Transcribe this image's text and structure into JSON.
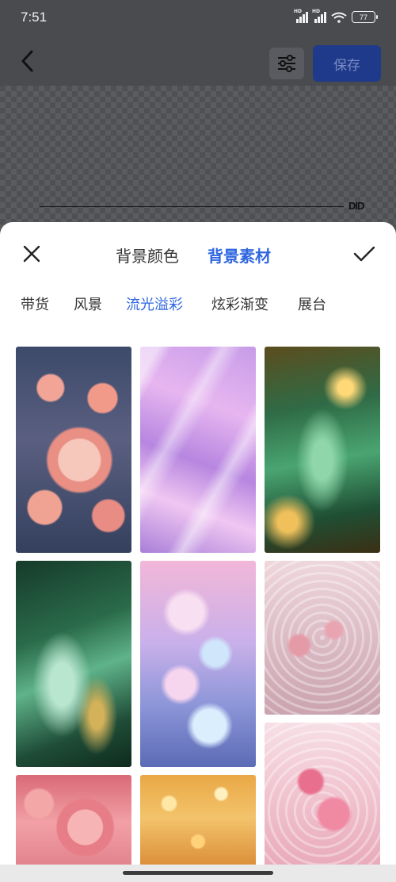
{
  "status": {
    "time": "7:51",
    "signal_tag": "HD",
    "battery": "77"
  },
  "toolbar": {
    "save_label": "保存"
  },
  "sheet": {
    "tabs": [
      {
        "label": "背景颜色",
        "active": false
      },
      {
        "label": "背景素材",
        "active": true
      }
    ],
    "categories": [
      {
        "label": "带货",
        "active": false
      },
      {
        "label": "风景",
        "active": false
      },
      {
        "label": "流光溢彩",
        "active": true
      },
      {
        "label": "炫彩渐变",
        "active": false
      },
      {
        "label": "展台",
        "active": false
      }
    ]
  },
  "colors": {
    "accent": "#2f66e0",
    "save_bg": "#1f3a8a"
  },
  "icons": [
    "back-arrow-icon",
    "adjust-sliders-icon",
    "close-icon",
    "check-icon",
    "wifi-icon",
    "battery-icon",
    "signal-icon"
  ],
  "images": [
    {
      "name": "thumb-pink-roses-water"
    },
    {
      "name": "thumb-iridescent-silk"
    },
    {
      "name": "thumb-green-gold-wave"
    },
    {
      "name": "thumb-green-gold-river"
    },
    {
      "name": "thumb-pastel-butterflies"
    },
    {
      "name": "thumb-pink-butterfly-ripples"
    },
    {
      "name": "thumb-pink-hearts-water"
    },
    {
      "name": "thumb-pink-roses-closeup"
    },
    {
      "name": "thumb-golden-bokeh"
    }
  ]
}
